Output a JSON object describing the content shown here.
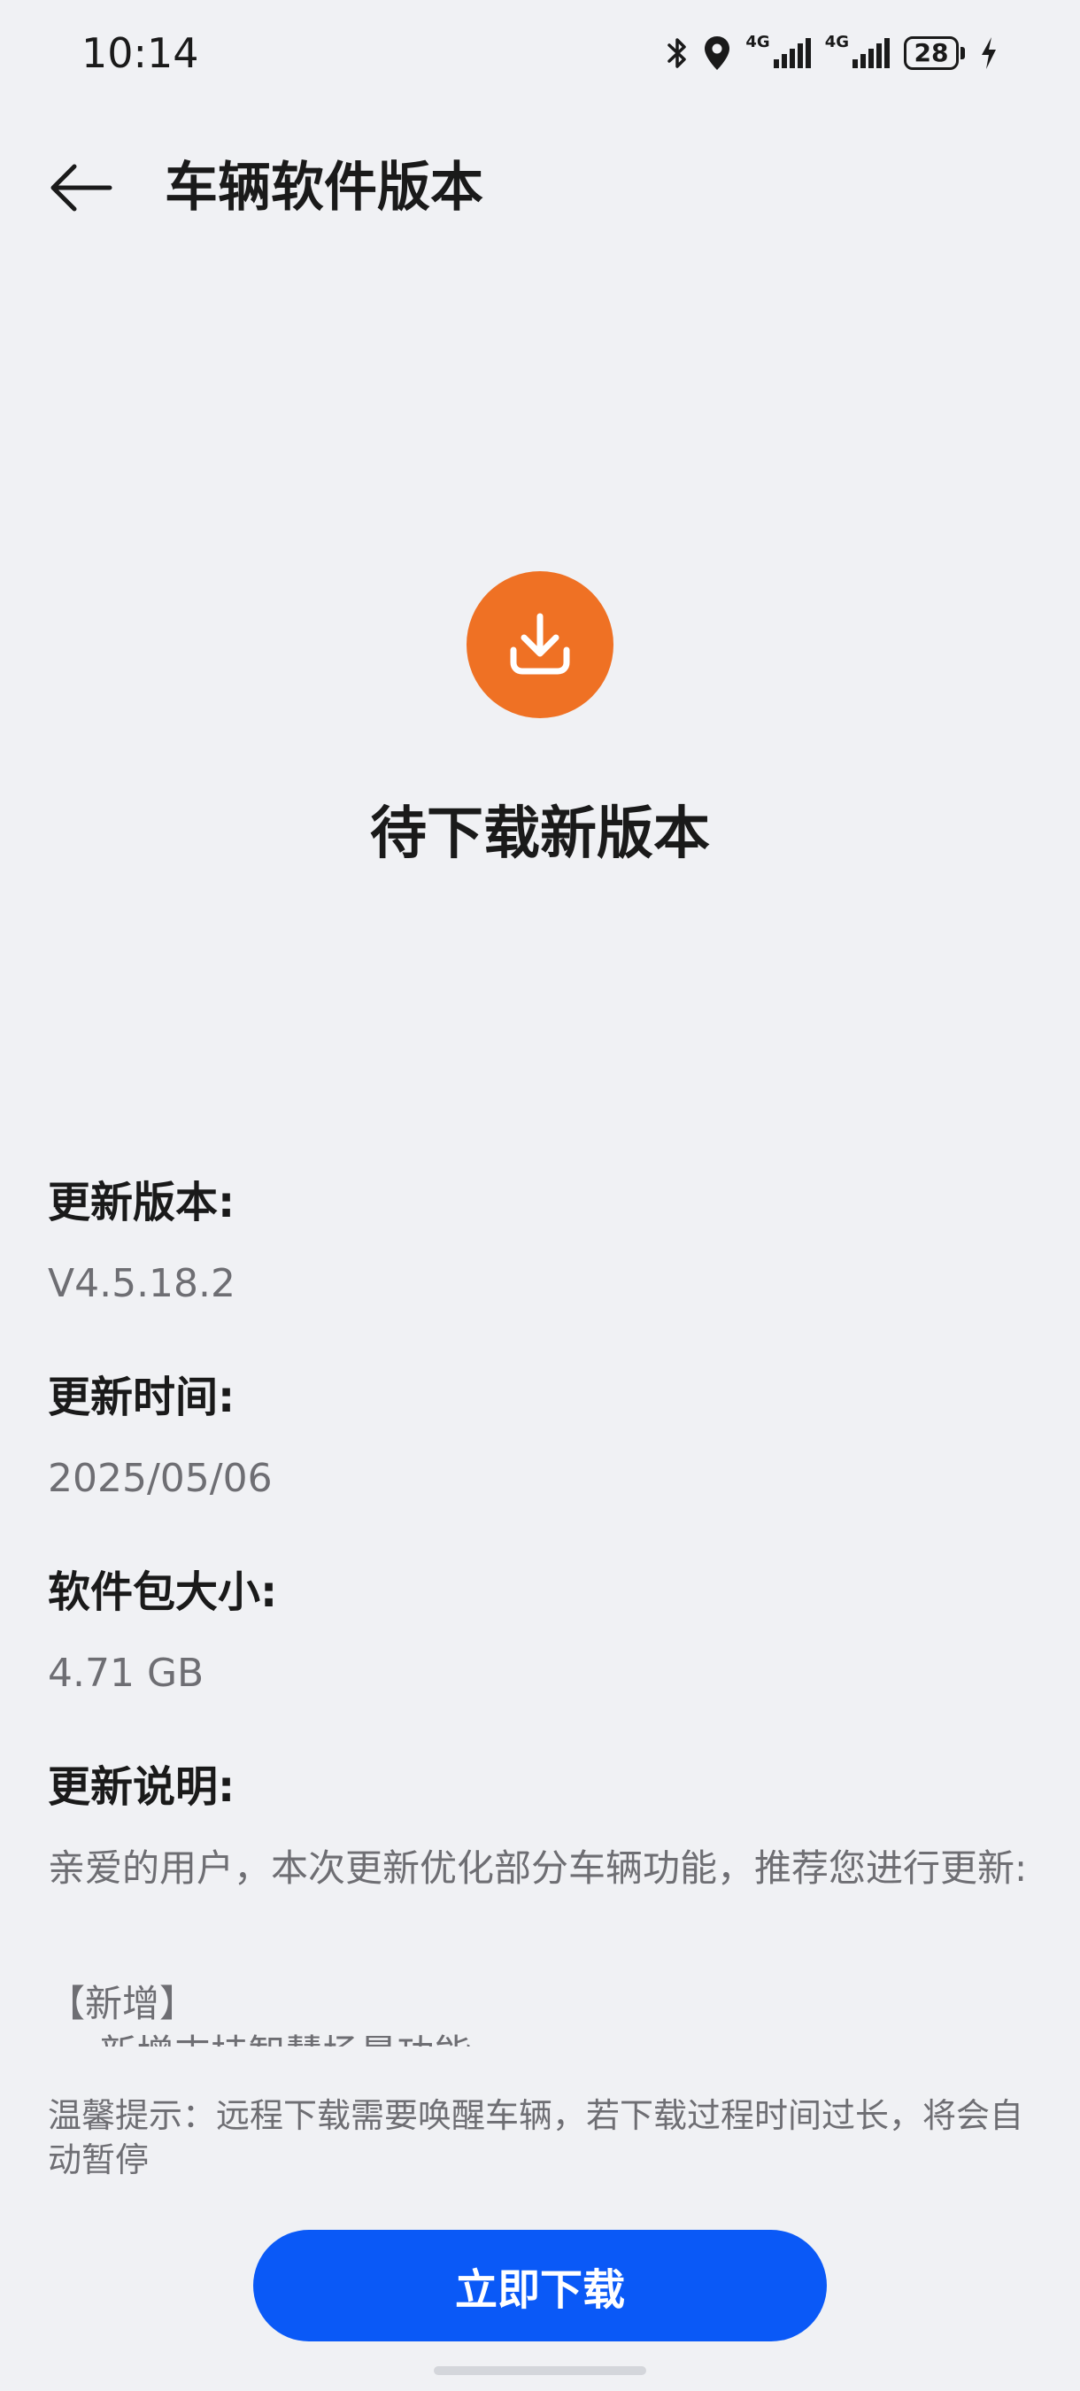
{
  "status_bar": {
    "time": "10:14",
    "network_1": "4G",
    "network_2": "4G",
    "battery": "28",
    "icons": [
      "bluetooth-icon",
      "location-icon",
      "signal-icon",
      "signal-icon",
      "battery-icon",
      "charging-icon"
    ]
  },
  "header": {
    "title": "车辆软件版本",
    "back_icon": "back-arrow-icon"
  },
  "status": {
    "icon": "download-icon",
    "icon_color": "#ef7124",
    "title": "待下载新版本"
  },
  "info": {
    "version_label": "更新版本:",
    "version_value": "V4.5.18.2",
    "date_label": "更新时间:",
    "date_value": "2025/05/06",
    "size_label": "软件包大小:",
    "size_value": "4.71 GB",
    "notes_label": "更新说明:",
    "notes_text": "亲爱的用户，本次更新优化部分车辆功能，推荐您进行更新:",
    "notes_section": "【新增】",
    "notes_first_item": "- 新增支持智慧场景功能"
  },
  "tip": "温馨提示：远程下载需要唤醒车辆，若下载过程时间过长，将会自动暂停",
  "button": {
    "label": "立即下载",
    "color": "#0a59f7"
  }
}
